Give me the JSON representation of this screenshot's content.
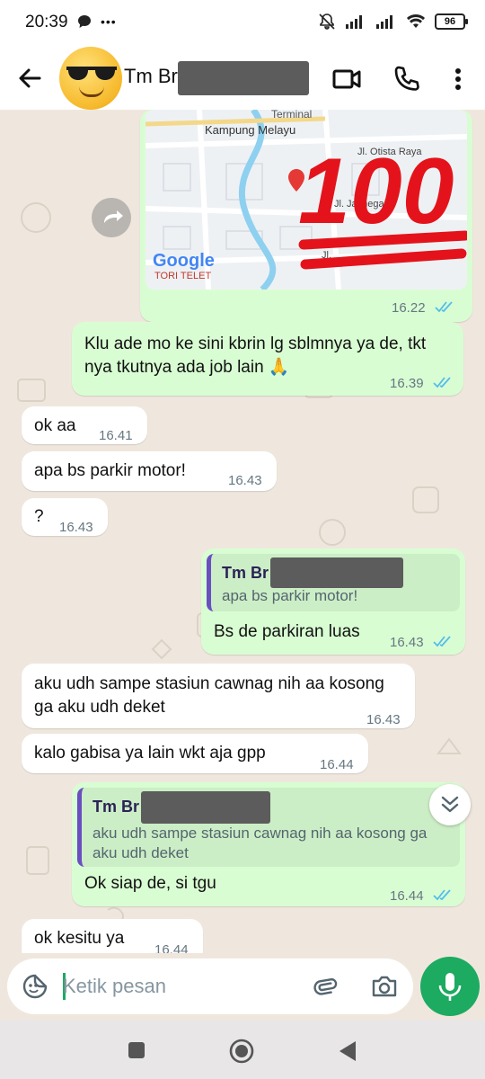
{
  "status_bar": {
    "time": "20:39",
    "dots": "•••",
    "battery": "96"
  },
  "header": {
    "contact_name": "Tm Br"
  },
  "messages": [
    {
      "direction": "out",
      "kind": "location",
      "time": "16.22",
      "map_labels": {
        "terminal": "Terminal",
        "area": "Kampung Melayu",
        "street_right": "Jl. Otista Raya",
        "street_r2": "Jl. Jatinegara",
        "street_left": "Jl.",
        "brand": "Google",
        "place": "TORI TELET",
        "emoji_text": "100"
      }
    },
    {
      "direction": "out",
      "text": "Klu ade mo ke sini kbrin lg sblmnya ya de, tkt nya tkutnya ada job lain 🙏",
      "time": "16.39"
    },
    {
      "direction": "in",
      "text": "ok aa",
      "time": "16.41"
    },
    {
      "direction": "in",
      "text": "apa bs parkir motor!",
      "time": "16.43"
    },
    {
      "direction": "in",
      "text": "?",
      "time": "16.43"
    },
    {
      "direction": "out",
      "quote_name": "Tm Br",
      "quote_text": "apa bs parkir motor!",
      "text": "Bs de parkiran luas",
      "time": "16.43"
    },
    {
      "direction": "in",
      "text": "aku udh sampe stasiun cawnag nih aa kosong ga aku udh deket",
      "time": "16.43"
    },
    {
      "direction": "in",
      "text": "kalo gabisa ya lain wkt aja gpp",
      "time": "16.44"
    },
    {
      "direction": "out",
      "quote_name": "Tm Br",
      "quote_text": "aku udh sampe stasiun cawnag nih aa kosong ga aku udh deket",
      "text": "Ok siap de, si tgu",
      "time": "16.44"
    },
    {
      "direction": "in",
      "text": "ok kesitu ya",
      "time": "16.44"
    }
  ],
  "composer": {
    "placeholder": "Ketik pesan"
  },
  "icons": {
    "back": "arrow-left-icon",
    "video": "video-camera-icon",
    "call": "phone-icon",
    "menu": "more-vert-icon",
    "sticker": "sticker-icon",
    "attach": "paperclip-icon",
    "camera": "camera-icon",
    "mic": "microphone-icon",
    "forward": "forward-icon",
    "scroll": "chevrons-down-icon"
  },
  "colors": {
    "outgoing": "#d9fdd3",
    "incoming": "#ffffff",
    "accent": "#1daa61",
    "tick": "#53bdeb",
    "quote_bar": "#6a4fc1"
  }
}
